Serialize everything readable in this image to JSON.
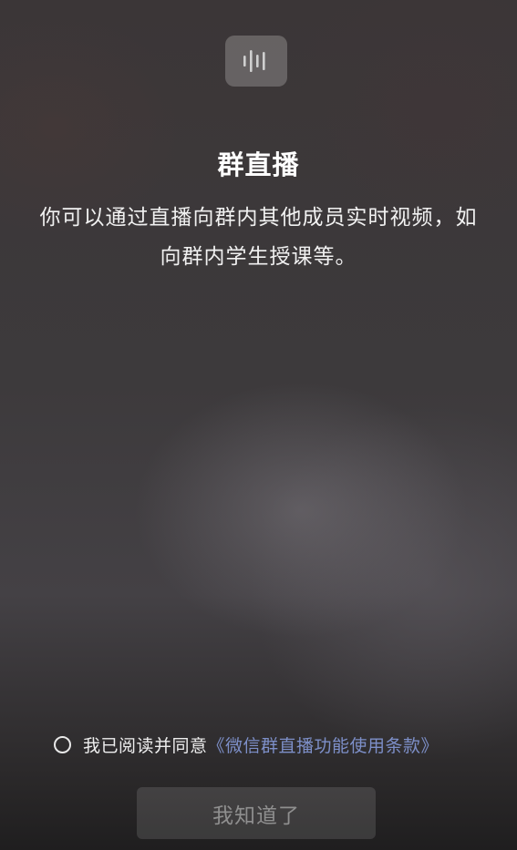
{
  "header": {
    "icon": "voice-waveform-icon",
    "title": "群直播"
  },
  "intro": {
    "line1": "你可以通过直播向群内其他成员实时视频，如",
    "line2": "向群内学生授课等。"
  },
  "agreement": {
    "checked": false,
    "prefix": "我已阅读并同意",
    "terms_link": "《微信群直播功能使用条款》"
  },
  "actions": {
    "confirm_label": "我知道了"
  },
  "colors": {
    "link": "#7d8fc8",
    "button_text_disabled": "#8f8f8f",
    "title": "#ffffff"
  }
}
